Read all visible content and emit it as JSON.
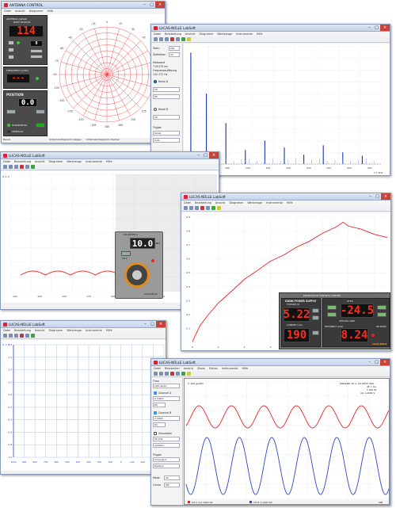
{
  "win1": {
    "title": "ANTENNA CONTROL",
    "menu": [
      "Datei",
      "Ansicht",
      "Diagramm",
      "Hilfe"
    ],
    "panel1_title": "ANTENNA (GEAR)",
    "panel1_sub": "MODE POSITION",
    "display1": "114",
    "panel2_title": "FREQUENCY (GHz)",
    "display2": "---",
    "panel3_title": "POSITION",
    "display3": "0.0",
    "hor_label": "HORIZONTAL",
    "ver_label": "VERTICAL",
    "polar_labels": [
      "0",
      "15",
      "30",
      "45",
      "60",
      "75",
      "90",
      "105",
      "120",
      "135",
      "150",
      "165",
      "180",
      "-165",
      "-150",
      "-135",
      "-120",
      "-105",
      "-90",
      "-75",
      "-60",
      "-45",
      "-30",
      "-15"
    ],
    "status": "Bereit",
    "bottom_items": [
      "Antennendiagramm zeigen",
      "Antennendiagramm löschen"
    ]
  },
  "win2": {
    "title": "LUCAS-NÜLLE LabSoft",
    "menu": [
      "Datei",
      "Bearbeitung",
      "Ansicht",
      "Diagramm",
      "Werkzeuge",
      "Instrumente",
      "Hilfe"
    ],
    "fields": [
      {
        "label": "Start:",
        "value": "201"
      },
      {
        "label": "Zeitfaktor:",
        "value": "10"
      }
    ],
    "measure_title": "Messwert",
    "measure_lines": [
      "7.00175 ms",
      "Frequenzauflösung",
      "142.172 Hz"
    ],
    "channel_a": "Kanal A",
    "channel_b": "Kanal B",
    "trigger": "Trigger",
    "x_ticks": [
      "0",
      "50",
      "100",
      "150",
      "200",
      "250",
      "300",
      "350",
      "400",
      "450"
    ],
    "x_unit": "f in kHz",
    "spectrum": [
      [
        10,
        0.95
      ],
      [
        50,
        0.6
      ],
      [
        100,
        0.35
      ],
      [
        150,
        0.12
      ],
      [
        200,
        0.2
      ],
      [
        250,
        0.14
      ],
      [
        300,
        0.08
      ],
      [
        350,
        0.16
      ],
      [
        400,
        0.1
      ],
      [
        450,
        0.07
      ]
    ],
    "bottom_labels": [
      {
        "label": "U1 [V]:",
        "value": "0"
      },
      {
        "label": "f1 [Hz]:",
        "value": "0"
      }
    ]
  },
  "win3": {
    "title": "LUCAS-NÜLLE LabSoft",
    "menu": [
      "Datei",
      "Bearbeitung",
      "Ansicht",
      "Diagramm",
      "Werkzeuge",
      "Instrumente",
      "Hilfe"
    ],
    "y_unit": "U in V",
    "x_ticks": [
      "100",
      "125",
      "150",
      "175",
      "200",
      "225",
      "250",
      "275",
      "300"
    ],
    "x_values": [
      100,
      125,
      150,
      175,
      200,
      225,
      250,
      275,
      300
    ],
    "meter_title": "dB METER A",
    "meter_value": "10.0",
    "meter_unit": "dBm",
    "meter_range": "20:1",
    "meter_brand": "LUCAS-NÜLLE"
  },
  "win4": {
    "title": "LUCAS-NÜLLE LabSoft",
    "menu": [
      "Datei",
      "Bearbeitung",
      "Ansicht",
      "Diagramm",
      "Werkzeuge",
      "Instrumente",
      "Hilfe"
    ],
    "x_ticks": [
      "0",
      "1",
      "2",
      "3",
      "4",
      "5",
      "6",
      "7"
    ],
    "y_ticks": [
      "0.1",
      "0.2",
      "0.3",
      "0.4",
      "0.5",
      "0.6",
      "0.7",
      "0.8",
      "0.9"
    ],
    "chart_data": {
      "type": "line",
      "x": [
        0,
        0.1,
        0.3,
        0.6,
        1,
        1.5,
        2,
        2.5,
        3,
        3.5,
        4,
        4.5,
        5,
        5.5,
        5.8,
        6,
        6.5,
        7,
        7.5
      ],
      "y": [
        0,
        0.05,
        0.12,
        0.2,
        0.28,
        0.37,
        0.45,
        0.52,
        0.58,
        0.63,
        0.68,
        0.73,
        0.78,
        0.83,
        0.86,
        0.84,
        0.81,
        0.78,
        0.75
      ],
      "xlim": [
        0,
        7.5
      ],
      "ylim": [
        0,
        0.9
      ]
    },
    "mw_title": "MICROWAVE CONTROL CENTER",
    "gunn_title": "GUNN POWER SUPPLY",
    "voltage_label": "VOLTAGE (V)",
    "voltage_value": "5.22",
    "current_label": "CURRENT (mA)",
    "current_value": "190",
    "attn_label": "ATTN",
    "attn_value": "-24.5",
    "attn_mode_label": "ATTN DIAL OWD",
    "freq_label": "FREQUENCY (GHz)",
    "freq_value": "8.24",
    "brand": "LUCAS-NÜLLE",
    "sub_label": "PIN DIODE"
  },
  "win5": {
    "title": "LUCAS-NÜLLE LabSoft",
    "menu": [
      "Datei",
      "Bearbeitung",
      "Ansicht",
      "Diagramm",
      "Werkzeuge",
      "Instrumente",
      "Hilfe"
    ],
    "y_unit": "U in V",
    "y_ticks": [
      "0.8",
      "0.6",
      "0.4",
      "0.2",
      "0.0",
      "-0.2",
      "-0.4",
      "-0.6",
      "-0.8",
      "-1.0"
    ],
    "x_ticks": [
      "1000",
      "900",
      "800",
      "700",
      "600",
      "500",
      "400",
      "300",
      "200",
      "100",
      "0",
      "-100",
      "-200",
      "-300",
      "-400"
    ]
  },
  "win6": {
    "title": "LUCAS-NÜLLE LabSoft",
    "menu": [
      "Datei",
      "Bearbeiten",
      "Ansicht",
      "Zoom",
      "Extras",
      "Instrumente",
      "Hilfe"
    ],
    "time_label": "Time",
    "time_value": "100 µs/div",
    "channel_a": "Channel A",
    "ch_a_value": "2 V/DIV",
    "channel_b": "Channel B",
    "ch_b_value": "2 V/DIV",
    "simulation": "Simulation",
    "sim_value": "50 kHz",
    "trigger": "Trigger",
    "trig_value": "Channel A",
    "mode_label": "Mode",
    "mode_value": "AC",
    "cursor_label": "Cursor",
    "cursor_value": "Off",
    "scope_header": "T: 100 µs/DIV",
    "scope_info": [
      "TRIGGER: CH A, 0% POST: 50%",
      "dT: 1 ms",
      "f: 200 Hz",
      "dU: 1.0000 V"
    ],
    "footer_a": "CH A: 2.0 V/DIV DC",
    "footer_b": "CH B: 2 V/DIV DC",
    "footer_right": "SIM"
  }
}
